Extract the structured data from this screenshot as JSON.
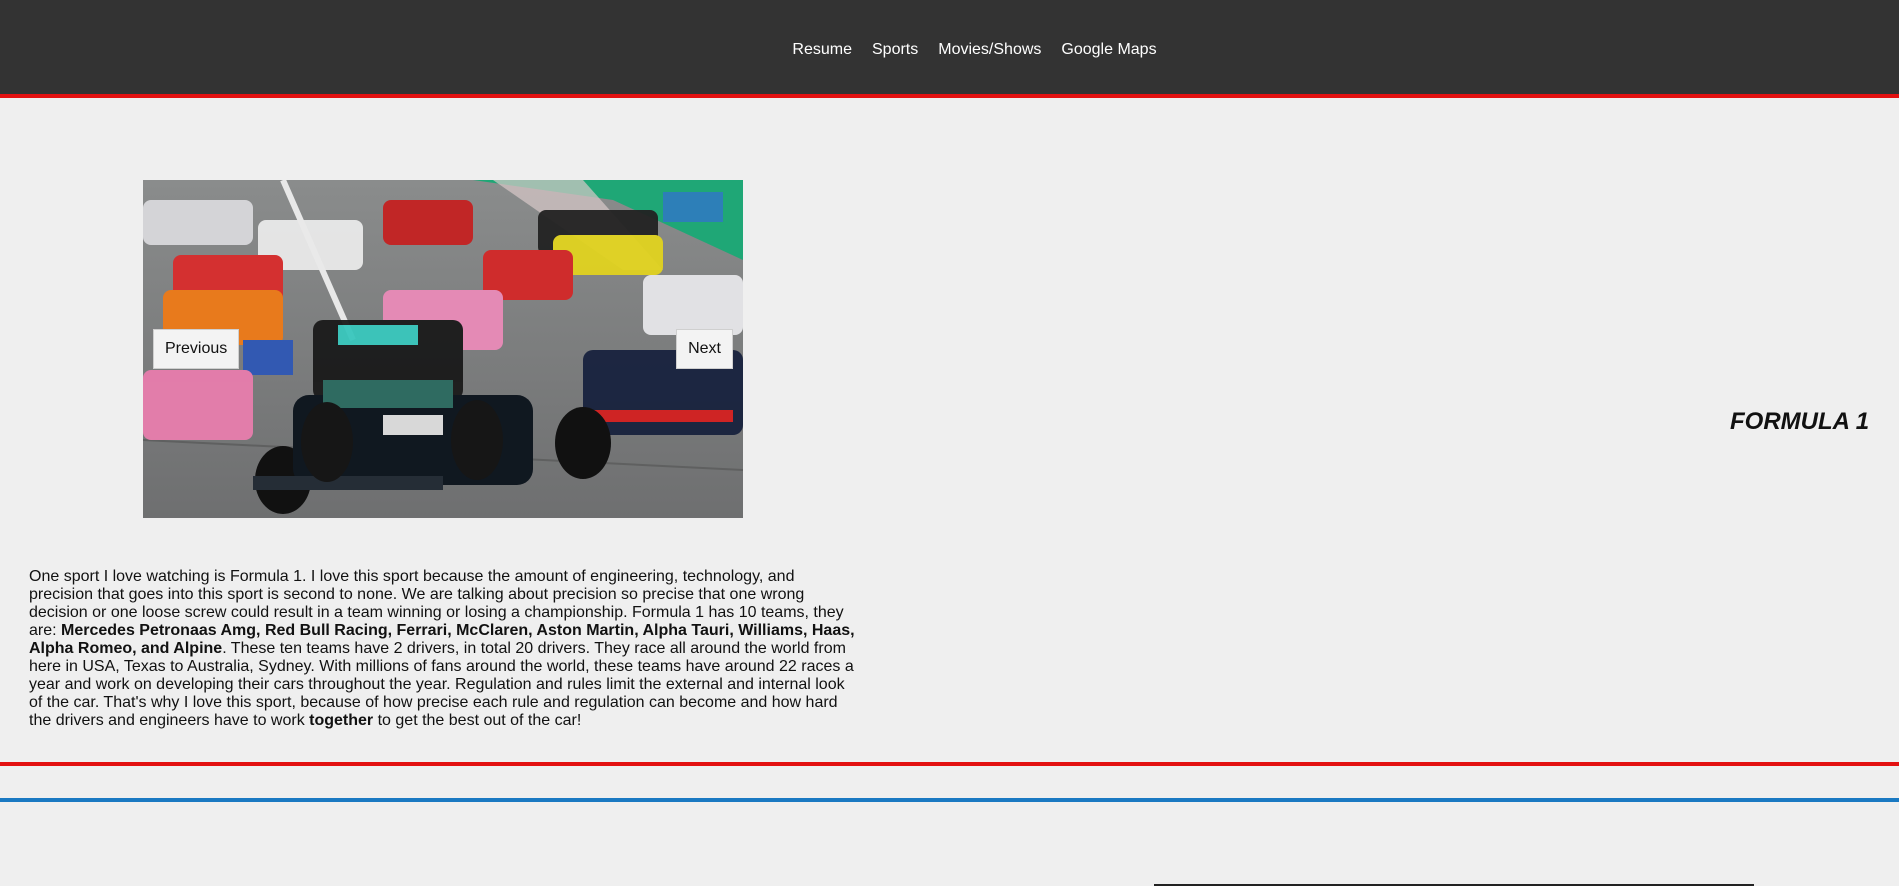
{
  "nav": {
    "items": [
      {
        "label": "Resume"
      },
      {
        "label": "Sports"
      },
      {
        "label": "Movies/Shows"
      },
      {
        "label": "Google Maps"
      }
    ]
  },
  "colors": {
    "nav_background": "#333333",
    "accent_red": "#e31111",
    "accent_blue": "#1a79c2",
    "page_background": "#efefef"
  },
  "slideshow": {
    "previous_label": "Previous",
    "next_label": "Next"
  },
  "section": {
    "title": "FORMULA 1",
    "paragraph": {
      "p1": "One sport I love watching is Formula 1. I love this sport because the amount of engineering, technology, and precision that goes into this sport is second to none. We are talking about precision so precise that one wrong decision or one loose screw could result in a team winning or losing a championship. Formula 1 has 10 teams, they are: ",
      "teams_bold": "Mercedes Petronaas Amg, Red Bull Racing, Ferrari, McClaren, Aston Martin, Alpha Tauri, Williams, Haas, Alpha Romeo, and Alpine",
      "p2": ". These ten teams have 2 drivers, in total 20 drivers. They race all around the world from here in USA, Texas to Australia, Sydney. With millions of fans around the world, these teams have around 22 races a year and work on developing their cars throughout the year. Regulation and rules limit the external and internal look of the car. That's why I love this sport, because of how precise each rule and regulation can become and how hard the drivers and engineers have to work ",
      "together_bold": "together",
      "p3": " to get the best out of the car!"
    }
  }
}
